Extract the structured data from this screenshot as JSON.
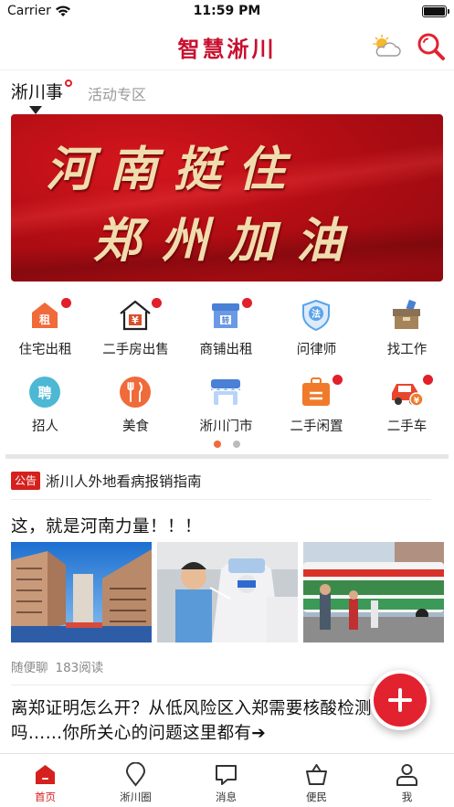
{
  "status_bar": {
    "carrier": "Carrier",
    "time": "11:59 PM"
  },
  "header": {
    "title": "智慧淅川"
  },
  "tabs": {
    "active": "淅川事",
    "inactive": "活动专区"
  },
  "banner": {
    "line1": "河南挺住",
    "line2": "郑州加油"
  },
  "grid": [
    {
      "label": "住宅出租",
      "icon": "house-rent-icon",
      "badge": true,
      "color": "#f06a3a"
    },
    {
      "label": "二手房出售",
      "icon": "house-sale-icon",
      "badge": true,
      "color": "#d94f2a"
    },
    {
      "label": "商铺出租",
      "icon": "shop-rent-icon",
      "badge": true,
      "color": "#4a80d6"
    },
    {
      "label": "问律师",
      "icon": "lawyer-icon",
      "badge": false,
      "color": "#5aa4e8"
    },
    {
      "label": "找工作",
      "icon": "job-icon",
      "badge": false,
      "color": "#a5845a"
    },
    {
      "label": "招人",
      "icon": "recruit-icon",
      "badge": false,
      "color": "#4cb8d4"
    },
    {
      "label": "美食",
      "icon": "food-icon",
      "badge": false,
      "color": "#f06a3a"
    },
    {
      "label": "淅川门市",
      "icon": "storefront-icon",
      "badge": false,
      "color": "#4a80d6"
    },
    {
      "label": "二手闲置",
      "icon": "secondhand-icon",
      "badge": true,
      "color": "#f07a2a"
    },
    {
      "label": "二手车",
      "icon": "car-icon",
      "badge": true,
      "color": "#e8452c"
    }
  ],
  "pager": {
    "active_color": "#f06a3a",
    "inactive_color": "#bbbbbb"
  },
  "notice": {
    "tag": "公告",
    "text": "淅川人外地看病报销指南"
  },
  "article1": {
    "title": "这，就是河南力量！！！",
    "source": "随便聊",
    "reads": "183阅读"
  },
  "article2": {
    "title": "离郑证明怎么开？从低风险区入郑需要核酸检测证明吗……你所关心的问题这里都有➔"
  },
  "tabbar": [
    {
      "label": "首页",
      "icon": "home-icon",
      "active": true
    },
    {
      "label": "淅川圈",
      "icon": "location-pin-icon",
      "active": false
    },
    {
      "label": "消息",
      "icon": "message-icon",
      "active": false
    },
    {
      "label": "便民",
      "icon": "shopping-bag-icon",
      "active": false
    },
    {
      "label": "我",
      "icon": "person-icon",
      "active": false
    }
  ],
  "colors": {
    "brand": "#c8102e",
    "accent": "#d6201e"
  }
}
